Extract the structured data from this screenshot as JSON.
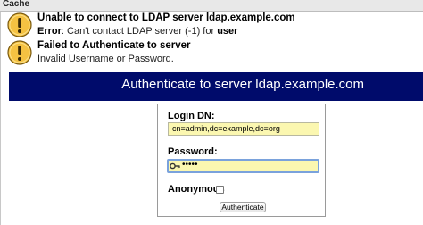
{
  "header": {
    "cache_label": "Cache"
  },
  "messages": [
    {
      "icon": "warning-icon",
      "title": "Unable to connect to LDAP server ldap.example.com",
      "body_prefix": "Error",
      "body_middle": ": Can't contact LDAP server (-1) for ",
      "body_suffix": "user"
    },
    {
      "icon": "warning-icon",
      "title": "Failed to Authenticate to server",
      "body": "Invalid Username or Password."
    }
  ],
  "banner": {
    "title": "Authenticate to server ldap.example.com",
    "color": "#000b6b"
  },
  "login_form": {
    "dn_label": "Login DN:",
    "dn_value": "cn=admin,dc=example,dc=org",
    "password_label": "Password:",
    "password_mask": "•••••",
    "anonymous_label": "Anonymous",
    "anonymous_checked": false,
    "submit_label": "Authenticate"
  },
  "colors": {
    "input_fill": "#fbf7b0",
    "focus_border": "#7aa2dc",
    "warning_fill": "#f5c242"
  }
}
